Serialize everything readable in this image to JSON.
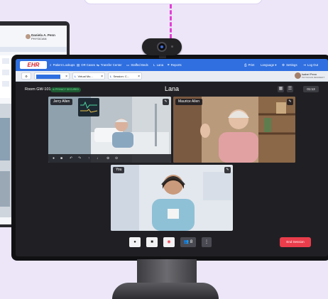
{
  "back_laptop": {
    "user_name": "Daniela A. Penn",
    "user_role": "PHYSICIAN"
  },
  "ehr": {
    "logo": "EHR",
    "nav": [
      {
        "icon": "search-icon",
        "glyph": "⌕",
        "label": "Patient Lookups"
      },
      {
        "icon": "clipboard-icon",
        "glyph": "▤",
        "label": "OR Cases"
      },
      {
        "icon": "transfer-icon",
        "glyph": "⇆",
        "label": "Transfer Center"
      },
      {
        "icon": "bed-icon",
        "glyph": "▭",
        "label": "Staffed Beds"
      },
      {
        "icon": "lana-icon",
        "glyph": "L",
        "label": "Lana"
      },
      {
        "icon": "chart-icon",
        "glyph": "⌗",
        "label": "Reports"
      }
    ],
    "right_nav": [
      {
        "icon": "print-icon",
        "glyph": "⎙",
        "label": "Print"
      },
      {
        "icon": "language-icon",
        "glyph": "",
        "label": "Language ▾"
      },
      {
        "icon": "gear-icon",
        "glyph": "⚙",
        "label": "Settings"
      },
      {
        "icon": "logout-icon",
        "glyph": "⇥",
        "label": "Log Out"
      }
    ],
    "tabs": [
      {
        "label": "",
        "close": "×"
      },
      {
        "label": "Virtual Mo...",
        "close": "×"
      },
      {
        "label": "Session: C...",
        "close": "×"
      }
    ],
    "user_name": "Isabel Penn",
    "user_role": "PHYSICIAN RESIDENT"
  },
  "session": {
    "room": "Room GW-101",
    "secured": "PRIVACY SECURED",
    "title": "Lana",
    "timer": "01:13"
  },
  "participants": [
    {
      "name": "Jerry Allen"
    },
    {
      "name": "Maurice Allen"
    },
    {
      "name": "You"
    }
  ],
  "controls": {
    "end_session": "End Session",
    "participants_count": "8"
  },
  "colors": {
    "ehr_blue": "#2f6fe0",
    "end_red": "#ea3d4c",
    "connector_magenta": "#e33fd6"
  }
}
